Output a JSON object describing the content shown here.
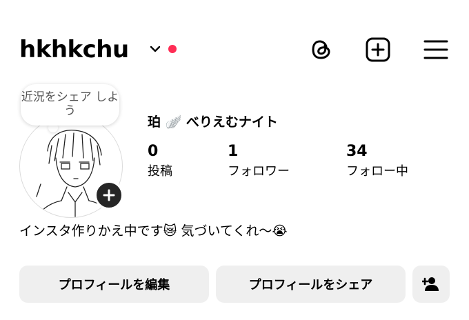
{
  "header": {
    "username": "hkhkchu",
    "status_color": "#ff2d55",
    "icons": [
      "threads-icon",
      "create-post-icon",
      "menu-icon"
    ]
  },
  "profile": {
    "note": "近況をシェア しよう",
    "display_name": "珀 🪽 べりえむナイト",
    "stats": [
      {
        "count": "0",
        "label": "投稿"
      },
      {
        "count": "1",
        "label": "フォロワー"
      },
      {
        "count": "34",
        "label": "フォロー中"
      }
    ],
    "bio": "インスタ作りかえ中です😿 気づいてくれ〜😭"
  },
  "actions": {
    "edit_label": "プロフィールを編集",
    "share_label": "プロフィールをシェア",
    "discover_icon": "add-person-icon"
  }
}
